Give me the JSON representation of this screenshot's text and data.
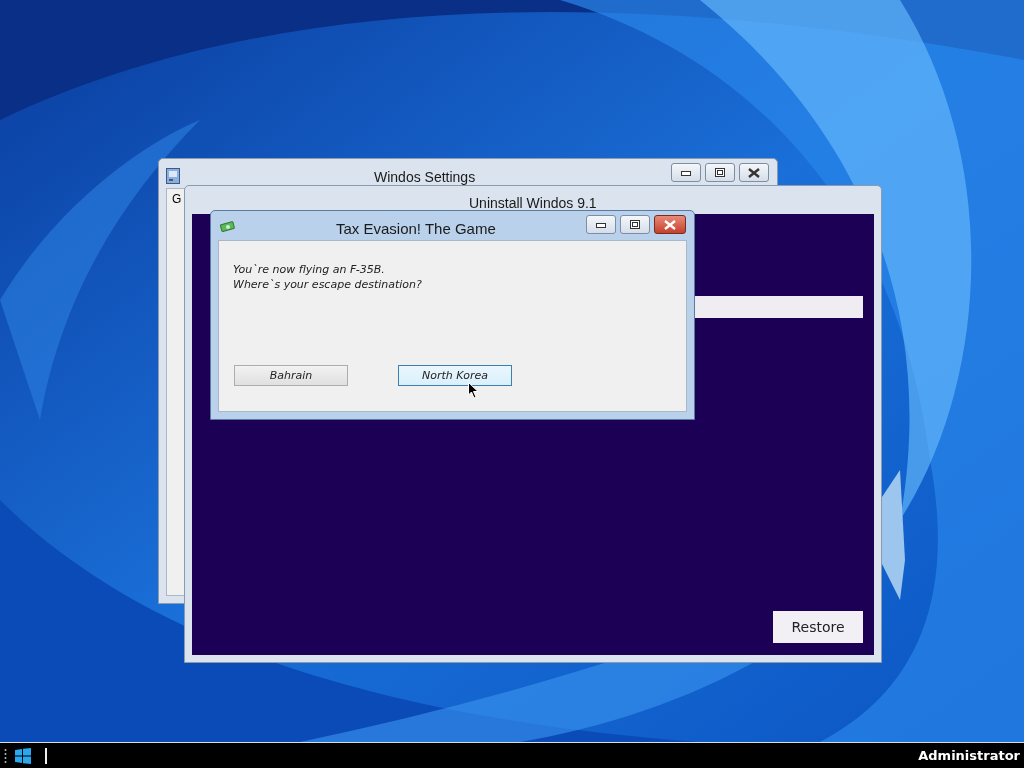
{
  "settings_window": {
    "title": "Windos Settings",
    "active": false,
    "content_text": "G"
  },
  "uninstall_window": {
    "title": "Uninstall Windos 9.1",
    "button": "Restore"
  },
  "dialog": {
    "title": "Tax Evasion! The Game",
    "active": true,
    "message": [
      "You`re now flying an F-35B.",
      "Where`s your escape destination?"
    ],
    "choices": [
      {
        "label": "Bahrain",
        "hovered": false
      },
      {
        "label": "North Korea",
        "hovered": true
      }
    ]
  },
  "taskbar": {
    "user": "Administrator"
  }
}
